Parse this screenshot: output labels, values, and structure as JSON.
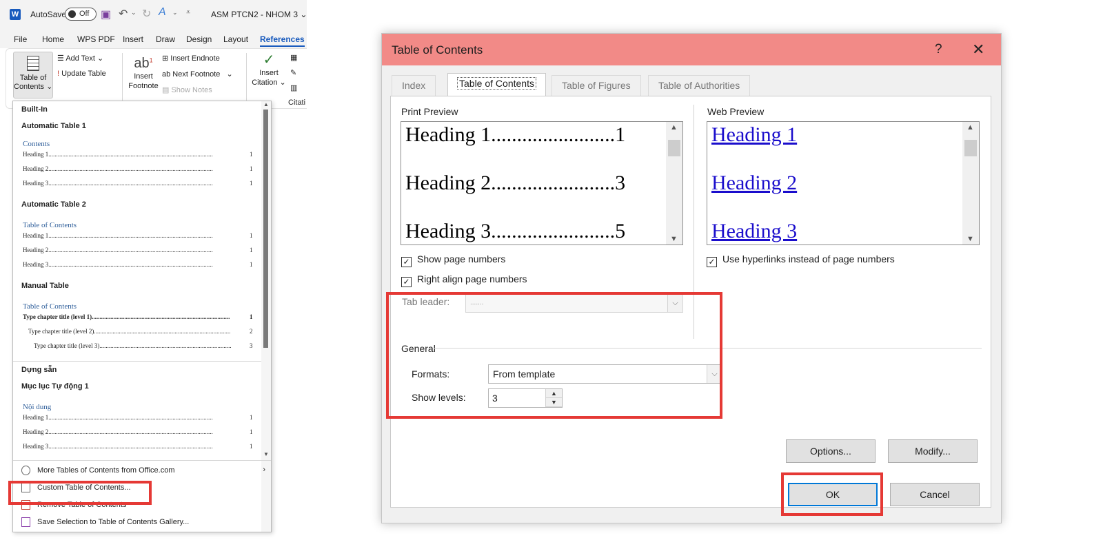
{
  "word": {
    "autosave_label": "AutoSave",
    "autosave_state": "Off",
    "doc_title": "ASM PTCN2 - NHOM 3",
    "tabs": [
      "File",
      "Home",
      "WPS PDF",
      "Insert",
      "Draw",
      "Design",
      "Layout",
      "References"
    ],
    "active_tab": "References",
    "ribbon": {
      "toc_line1": "Table of",
      "toc_line2": "Contents",
      "add_text": "Add Text",
      "update_table": "Update Table",
      "insert_footnote_1": "Insert",
      "insert_footnote_2": "Footnote",
      "insert_endnote": "Insert Endnote",
      "next_footnote": "Next Footnote",
      "show_notes": "Show Notes",
      "insert_citation_1": "Insert",
      "insert_citation_2": "Citation",
      "citation_cut": "Citati"
    },
    "gallery": {
      "section_builtin": "Built-In",
      "auto1": {
        "name": "Automatic Table 1",
        "title": "Contents",
        "lines": [
          {
            "text": "Heading 1",
            "page": "1"
          },
          {
            "text": "Heading 2",
            "page": "1"
          },
          {
            "text": "Heading 3",
            "page": "1"
          }
        ]
      },
      "auto2": {
        "name": "Automatic Table 2",
        "title": "Table of Contents",
        "lines": [
          {
            "text": "Heading 1",
            "page": "1"
          },
          {
            "text": "Heading 2",
            "page": "1"
          },
          {
            "text": "Heading 3",
            "page": "1"
          }
        ]
      },
      "manual": {
        "name": "Manual Table",
        "title": "Table of Contents",
        "lines": [
          {
            "text": "Type chapter title (level 1)",
            "page": "1"
          },
          {
            "text": "Type chapter title (level 2)",
            "page": "2"
          },
          {
            "text": "Type chapter title (level 3)",
            "page": "3"
          }
        ]
      },
      "section_dungsan": "Dựng sẵn",
      "vn": {
        "name": "Mục lục Tự động 1",
        "title": "Nội dung",
        "lines": [
          {
            "text": "Heading 1",
            "page": "1"
          },
          {
            "text": "Heading 2",
            "page": "1"
          },
          {
            "text": "Heading 3",
            "page": "1"
          }
        ]
      },
      "footer": {
        "more": "More Tables of Contents from Office.com",
        "custom": "Custom Table of Contents...",
        "remove": "Remove Table of Contents",
        "save": "Save Selection to Table of Contents Gallery..."
      }
    }
  },
  "dialog": {
    "title": "Table of Contents",
    "help": "?",
    "close": "✕",
    "tabs": [
      "Index",
      "Table of Contents",
      "Table of Figures",
      "Table of Authorities"
    ],
    "active_tab": "Table of Contents",
    "print_preview_label": "Print Preview",
    "print_rows": [
      {
        "text": "Heading 1",
        "dots": "........................",
        "page": "1"
      },
      {
        "text": "Heading 2",
        "dots": "........................",
        "page": "3"
      },
      {
        "text": "Heading 3",
        "dots": "........................",
        "page": "5"
      }
    ],
    "web_preview_label": "Web Preview",
    "web_rows": [
      "Heading 1",
      "Heading 2",
      "Heading 3"
    ],
    "show_page_numbers": {
      "label": "Show page numbers",
      "checked": true
    },
    "right_align": {
      "label": "Right align page numbers",
      "checked": true
    },
    "use_hyperlinks": {
      "label": "Use hyperlinks instead of page numbers",
      "checked": true
    },
    "tab_leader_label": "Tab leader:",
    "tab_leader_value": ".......",
    "general_label": "General",
    "formats_label": "Formats:",
    "formats_value": "From template",
    "show_levels_label": "Show levels:",
    "show_levels_value": "3",
    "options_button": "Options...",
    "modify_button": "Modify...",
    "ok_button": "OK",
    "cancel_button": "Cancel"
  },
  "colors": {
    "title_bar": "#f28a87",
    "highlight_box": "#e53935",
    "word_blue": "#185abd",
    "hyperlink": "#1a0dcc"
  }
}
